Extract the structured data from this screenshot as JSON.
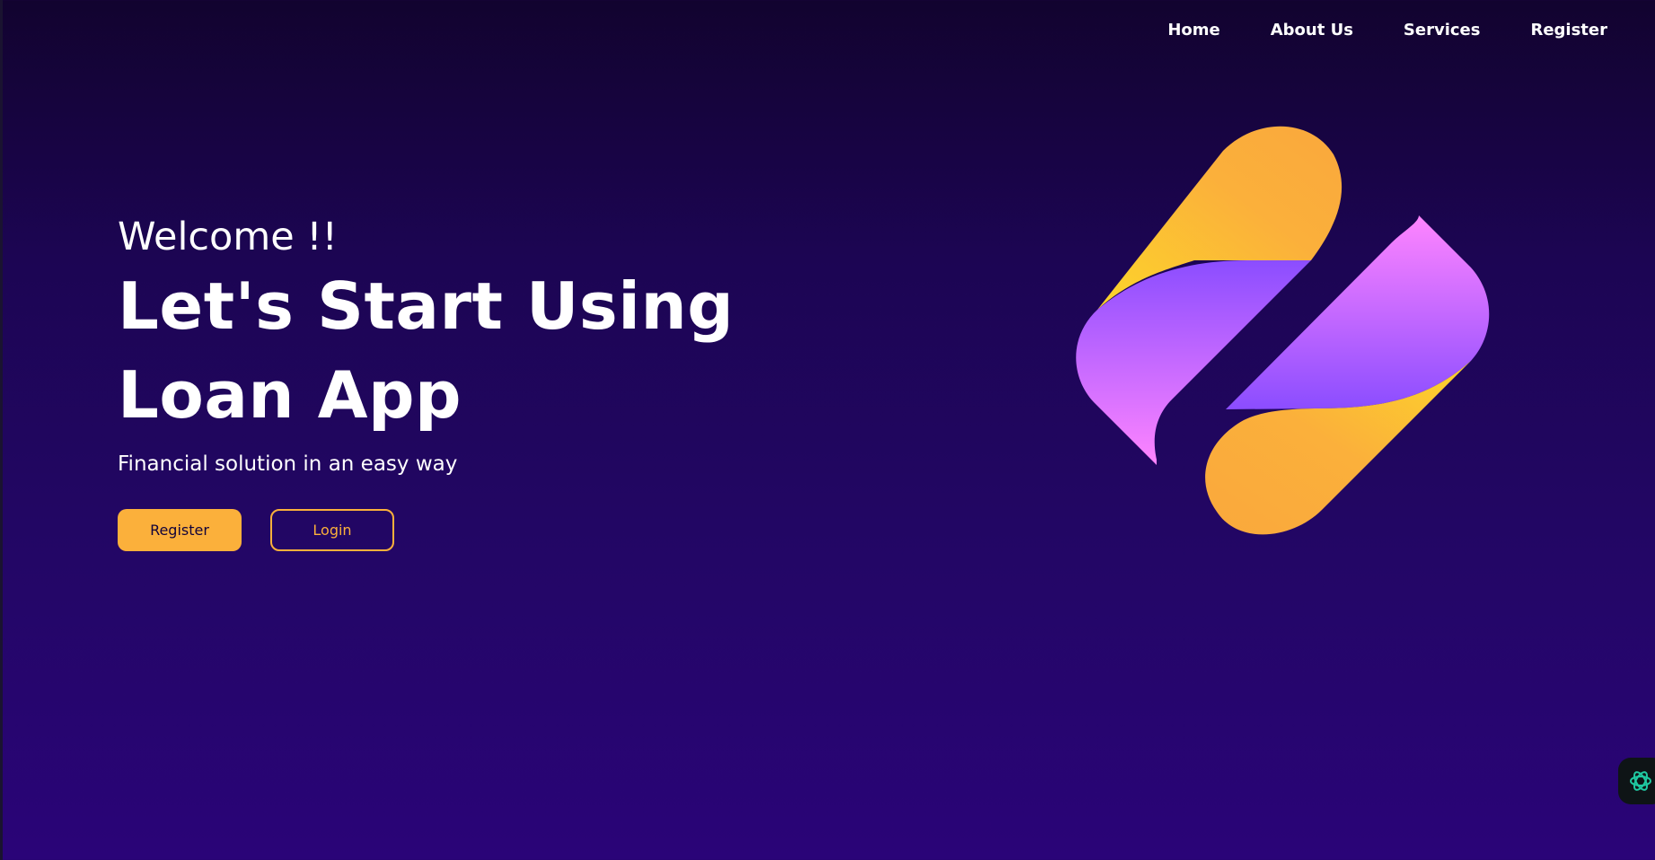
{
  "nav": {
    "items": [
      {
        "label": "Home"
      },
      {
        "label": "About Us"
      },
      {
        "label": "Services"
      },
      {
        "label": "Register"
      }
    ]
  },
  "hero": {
    "welcome": "Welcome !!",
    "headline_line1": "Let's Start Using",
    "headline_line2": "Loan App",
    "tagline": "Financial solution in an easy way",
    "register_label": "Register",
    "login_label": "Login"
  },
  "colors": {
    "accent": "#fbb03b",
    "background_top": "#12032f",
    "background_bottom": "#2a0478",
    "logo_purple": "#8b4dff",
    "logo_pink": "#ff85ff",
    "logo_yellow": "#fcd52a"
  },
  "icons": {
    "logo": "brand-logo-icon",
    "assistant": "openai-assistant-icon"
  }
}
